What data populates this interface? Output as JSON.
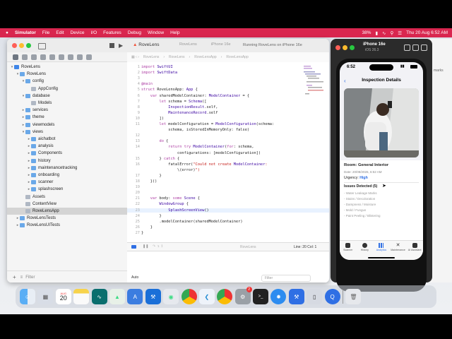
{
  "menubar": {
    "app_name": "Simulator",
    "items": [
      "File",
      "Edit",
      "Device",
      "I/O",
      "Features",
      "Debug",
      "Window",
      "Help"
    ],
    "battery": "38%",
    "datetime": "Thu 20 Aug  6:52 AM"
  },
  "xcode": {
    "tab_label": "RoveLens",
    "jump_items": [
      "RoveLens",
      "RoveLens",
      "RoveLensApp",
      "RoveLensApp"
    ],
    "toolbar_targets": [
      "RoveLens",
      "iPhone 16e"
    ],
    "run_status": "Running RoveLens on iPhone 16e",
    "tree": [
      {
        "label": "RoveLens",
        "level": 0,
        "kind": "proj",
        "chev": "v"
      },
      {
        "label": "RoveLens",
        "level": 1,
        "kind": "folder",
        "chev": "v"
      },
      {
        "label": "config",
        "level": 2,
        "kind": "folder",
        "chev": "v"
      },
      {
        "label": "AppConfig",
        "level": 3,
        "kind": "file",
        "chev": ""
      },
      {
        "label": "database",
        "level": 2,
        "kind": "folder",
        "chev": "v"
      },
      {
        "label": "Models",
        "level": 3,
        "kind": "file",
        "chev": ""
      },
      {
        "label": "services",
        "level": 2,
        "kind": "folder",
        "chev": ">"
      },
      {
        "label": "theme",
        "level": 2,
        "kind": "folder",
        "chev": ">"
      },
      {
        "label": "viewmodels",
        "level": 2,
        "kind": "folder",
        "chev": ">"
      },
      {
        "label": "views",
        "level": 2,
        "kind": "folder",
        "chev": "v"
      },
      {
        "label": "aichatbot",
        "level": 3,
        "kind": "folder",
        "chev": ">"
      },
      {
        "label": "analysis",
        "level": 3,
        "kind": "folder",
        "chev": ">"
      },
      {
        "label": "Components",
        "level": 3,
        "kind": "folder",
        "chev": ">"
      },
      {
        "label": "history",
        "level": 3,
        "kind": "folder",
        "chev": ">"
      },
      {
        "label": "maintenancetracking",
        "level": 3,
        "kind": "folder",
        "chev": ">"
      },
      {
        "label": "onboarding",
        "level": 3,
        "kind": "folder",
        "chev": ">"
      },
      {
        "label": "scanner",
        "level": 3,
        "kind": "folder",
        "chev": ">"
      },
      {
        "label": "splashscreen",
        "level": 3,
        "kind": "folder",
        "chev": ">"
      },
      {
        "label": "Assets",
        "level": 2,
        "kind": "file",
        "chev": ""
      },
      {
        "label": "ContentView",
        "level": 2,
        "kind": "file",
        "chev": ""
      },
      {
        "label": "RoveLensApp",
        "level": 2,
        "kind": "file",
        "chev": "",
        "selected": true
      },
      {
        "label": "RoveLensTests",
        "level": 1,
        "kind": "folder",
        "chev": ">"
      },
      {
        "label": "RoveLensUITests",
        "level": 1,
        "kind": "folder",
        "chev": ">"
      }
    ],
    "filter_placeholder": "Filter",
    "code_lines": [
      {
        "n": "1",
        "t": "import SwiftUI"
      },
      {
        "n": "2",
        "t": "import SwiftData"
      },
      {
        "n": "3",
        "t": ""
      },
      {
        "n": "4",
        "t": "@main"
      },
      {
        "n": "5",
        "t": "struct RoveLensApp: App {"
      },
      {
        "n": "6",
        "t": "    var sharedModelContainer: ModelContainer = {"
      },
      {
        "n": "7",
        "t": "        let schema = Schema(["
      },
      {
        "n": "8",
        "t": "            InspectionResult.self,"
      },
      {
        "n": "9",
        "t": "            MaintenanceRecord.self"
      },
      {
        "n": "10",
        "t": "        ])"
      },
      {
        "n": "11",
        "t": "        let modelConfiguration = ModelConfiguration(schema:"
      },
      {
        "n": "",
        "t": "            schema, isStoredInMemoryOnly: false)"
      },
      {
        "n": "12",
        "t": ""
      },
      {
        "n": "13",
        "t": "        do {"
      },
      {
        "n": "14",
        "t": "            return try ModelContainer(for: schema,"
      },
      {
        "n": "",
        "t": "                configurations: [modelConfiguration])"
      },
      {
        "n": "15",
        "t": "        } catch {"
      },
      {
        "n": "16",
        "t": "            fatalError(\"Could not create ModelContainer:"
      },
      {
        "n": "",
        "t": "                \\(error)\")"
      },
      {
        "n": "17",
        "t": "        }"
      },
      {
        "n": "18",
        "t": "    }()"
      },
      {
        "n": "19",
        "t": ""
      },
      {
        "n": "20",
        "t": ""
      },
      {
        "n": "21",
        "t": "    var body: some Scene {"
      },
      {
        "n": "22",
        "t": "        WindowGroup {"
      },
      {
        "n": "23",
        "t": "            SplashScreenView()"
      },
      {
        "n": "24",
        "t": "        }"
      },
      {
        "n": "25",
        "t": "        .modelContainer(sharedModelContainer)"
      },
      {
        "n": "26",
        "t": "    }"
      },
      {
        "n": "27",
        "t": "}"
      }
    ],
    "cursor_pos": "Line: 20  Col: 1",
    "debug_target": "RoveLens",
    "console_mode": "Auto",
    "console_filter": "Filter"
  },
  "simulator": {
    "device": "iPhone 16e",
    "os": "iOS 26.3",
    "time": "6:52",
    "nav_title": "Inspection Details",
    "room": "Room: General Interior",
    "date": "Date: 20/08/2026, 6:52 AM",
    "urgency_label": "Urgency:",
    "urgency_value": "High",
    "issues_title": "Issues Detected (5)",
    "issues": [
      "- Water Leakage Marks",
      "- Stains / Decoloration",
      "- Dampness / Moisture",
      "- Mold / Fungus",
      "- Paint Peeling / Blistering"
    ],
    "tabs": [
      {
        "label": "Scanner",
        "icon": "camera-icon"
      },
      {
        "label": "History",
        "icon": "clock-icon"
      },
      {
        "label": "Analytics",
        "icon": "chart-icon",
        "active": true
      },
      {
        "label": "Maintenance",
        "icon": "wrench-icon"
      },
      {
        "label": "AI Assistant",
        "icon": "chat-icon"
      }
    ]
  },
  "background_window_text": "marks",
  "dock": {
    "calendar_month": "AUG",
    "calendar_day": "20",
    "badge_count": "2",
    "apps": [
      "finder-icon",
      "launchpad-icon",
      "calendar-icon",
      "notes-icon",
      "stocks-icon",
      "android-studio-icon",
      "xcode-instruments-icon",
      "xcode-icon",
      "android-icon",
      "chrome-icon",
      "vscode-icon",
      "chrome-icon",
      "settings-icon",
      "terminal-icon",
      "safari-icon",
      "xcode-build-icon",
      "simulator-icon",
      "quicktime-icon",
      "trash-icon"
    ]
  },
  "colors": {
    "menubar": "#d9264f",
    "accent": "#2f6fe4",
    "urgency": "#2f6fe4"
  }
}
